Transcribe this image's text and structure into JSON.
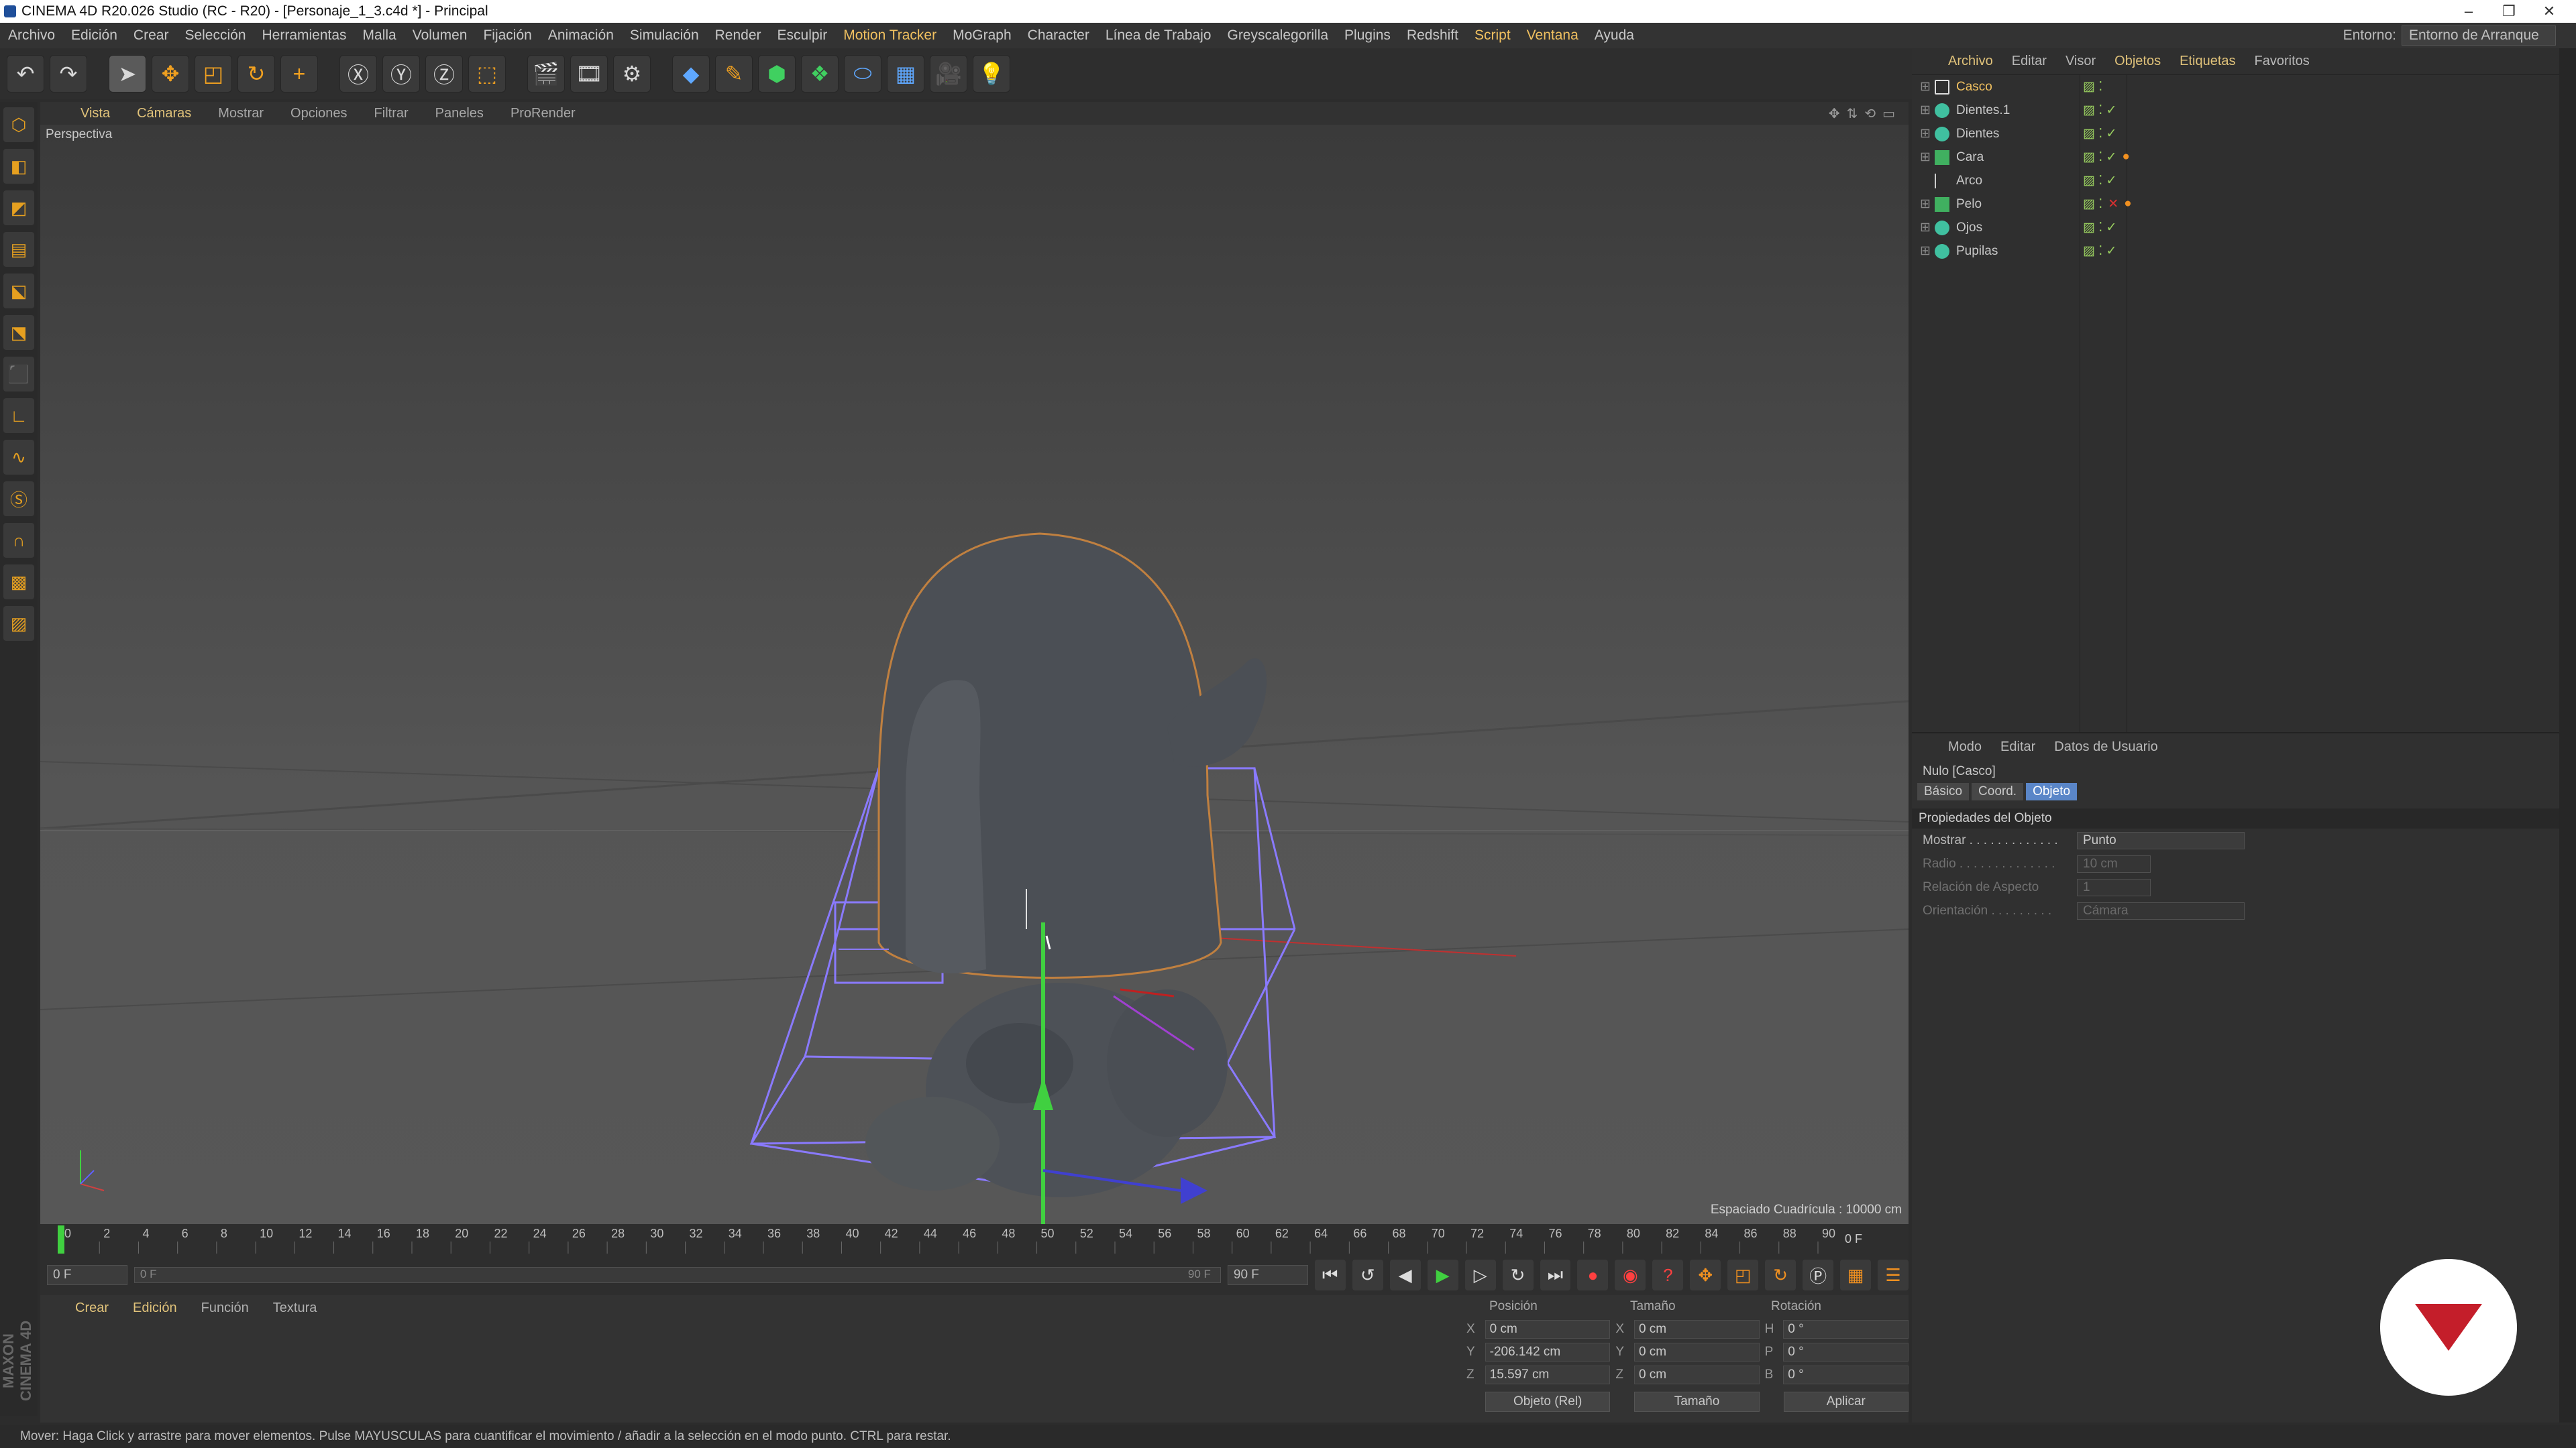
{
  "window": {
    "title": "CINEMA 4D R20.026 Studio (RC - R20) - [Personaje_1_3.c4d *] - Principal",
    "controls": [
      "–",
      "❐",
      "✕"
    ]
  },
  "menu": {
    "items": [
      "Archivo",
      "Edición",
      "Crear",
      "Selección",
      "Herramientas",
      "Malla",
      "Volumen",
      "Fijación",
      "Animación",
      "Simulación",
      "Render",
      "Esculpir",
      "Motion Tracker",
      "MoGraph",
      "Character",
      "Línea de Trabajo",
      "Greyscalegorilla",
      "Plugins",
      "Redshift",
      "Script",
      "Ventana",
      "Ayuda"
    ],
    "env_label": "Entorno:",
    "env_value": "Entorno de Arranque"
  },
  "viewport": {
    "menu": [
      "Vista",
      "Cámaras",
      "Mostrar",
      "Opciones",
      "Filtrar",
      "Paneles",
      "ProRender"
    ],
    "label": "Perspectiva",
    "grid_spacing": "Espaciado Cuadrícula : 10000 cm"
  },
  "timeline": {
    "ticks": [
      "0",
      "2",
      "4",
      "6",
      "8",
      "10",
      "12",
      "14",
      "16",
      "18",
      "20",
      "22",
      "24",
      "26",
      "28",
      "30",
      "32",
      "34",
      "36",
      "38",
      "40",
      "42",
      "44",
      "46",
      "48",
      "50",
      "52",
      "54",
      "56",
      "58",
      "60",
      "62",
      "64",
      "66",
      "68",
      "70",
      "72",
      "74",
      "76",
      "78",
      "80",
      "82",
      "84",
      "86",
      "88",
      "90"
    ],
    "current_frame": "0 F",
    "start": "0 F",
    "slider_start": "0 F",
    "slider_end": "90 F",
    "end": "90 F"
  },
  "materials": {
    "menu": [
      "Crear",
      "Edición",
      "Función",
      "Textura"
    ]
  },
  "coords": {
    "headers": [
      "Posición",
      "Tamaño",
      "Rotación"
    ],
    "rows": [
      {
        "pl": "X",
        "pos": "0 cm",
        "sl": "X",
        "size": "0 cm",
        "rl": "H",
        "rot": "0 °"
      },
      {
        "pl": "Y",
        "pos": "-206.142 cm",
        "sl": "Y",
        "size": "0 cm",
        "rl": "P",
        "rot": "0 °"
      },
      {
        "pl": "Z",
        "pos": "15.597 cm",
        "sl": "Z",
        "size": "0 cm",
        "rl": "B",
        "rot": "0 °"
      }
    ],
    "mode": "Objeto (Rel)",
    "size_mode": "Tamaño",
    "apply": "Aplicar"
  },
  "objects": {
    "menu": [
      "Archivo",
      "Editar",
      "Visor",
      "Objetos",
      "Etiquetas",
      "Favoritos"
    ],
    "list": [
      {
        "name": "Casco",
        "selected": true
      },
      {
        "name": "Dientes.1",
        "selected": false
      },
      {
        "name": "Dientes",
        "selected": false
      },
      {
        "name": "Cara",
        "selected": false
      },
      {
        "name": "Arco",
        "selected": false
      },
      {
        "name": "Pelo",
        "selected": false
      },
      {
        "name": "Ojos",
        "selected": false
      },
      {
        "name": "Pupilas",
        "selected": false
      }
    ]
  },
  "attributes": {
    "menu": [
      "Modo",
      "Editar",
      "Datos de Usuario"
    ],
    "title": "Nulo [Casco]",
    "tabs": [
      "Básico",
      "Coord.",
      "Objeto"
    ],
    "section": "Propiedades del Objeto",
    "props": [
      {
        "label": "Mostrar . . . . . . . . . . . . .",
        "value": "Punto",
        "enabled": true
      },
      {
        "label": "Radio . . . . . . . . . . . . . .",
        "value": "10 cm",
        "enabled": false
      },
      {
        "label": "Relación de Aspecto",
        "value": "1",
        "enabled": false
      },
      {
        "label": "Orientación . . . . . . . . .",
        "value": "Cámara",
        "enabled": false
      }
    ]
  },
  "status": "Mover: Haga Click y arrastre para mover elementos. Pulse MAYUSCULAS para cuantificar el movimiento / añadir a la selección en el modo punto. CTRL para restar."
}
